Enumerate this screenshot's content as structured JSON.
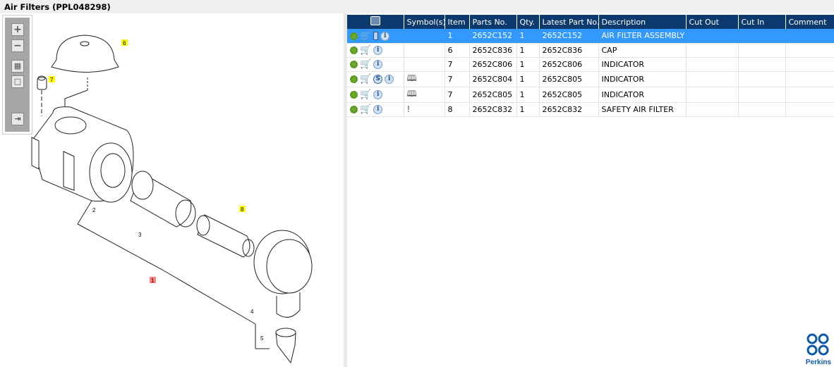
{
  "title": "Air Filters (PPL048298)",
  "toolbar": {
    "zoom_in": "+",
    "zoom_out": "−",
    "fit": "▦",
    "single": "□",
    "export": "⇥"
  },
  "callouts": {
    "c6": "6",
    "c7": "7",
    "c2": "2",
    "c3": "3",
    "c8": "8",
    "c1": "1",
    "c4": "4",
    "c5": "5"
  },
  "table": {
    "headers": [
      "",
      "Symbol(s)",
      "Item",
      "Parts No.",
      "Qty.",
      "Latest Part No.",
      "Description",
      "Cut Out",
      "Cut In",
      "Comment"
    ],
    "rows": [
      {
        "item": "1",
        "parts_no": "2652C152",
        "qty": "1",
        "latest": "2652C152",
        "desc": "AIR FILTER ASSEMBLY",
        "symbol": "",
        "selected": true
      },
      {
        "item": "6",
        "parts_no": "2652C836",
        "qty": "1",
        "latest": "2652C836",
        "desc": "CAP",
        "symbol": ""
      },
      {
        "item": "7",
        "parts_no": "2652C806",
        "qty": "1",
        "latest": "2652C806",
        "desc": "INDICATOR",
        "symbol": ""
      },
      {
        "item": "7",
        "parts_no": "2652C804",
        "qty": "1",
        "latest": "2652C805",
        "desc": "INDICATOR",
        "symbol": "🕮",
        "s": "S"
      },
      {
        "item": "7",
        "parts_no": "2652C805",
        "qty": "1",
        "latest": "2652C805",
        "desc": "INDICATOR",
        "symbol": "🕮"
      },
      {
        "item": "8",
        "parts_no": "2652C832",
        "qty": "1",
        "latest": "2652C832",
        "desc": "SAFETY AIR FILTER",
        "symbol": "!"
      }
    ]
  },
  "logo": {
    "text": "Perkins",
    "color": "#0d5ba8"
  }
}
